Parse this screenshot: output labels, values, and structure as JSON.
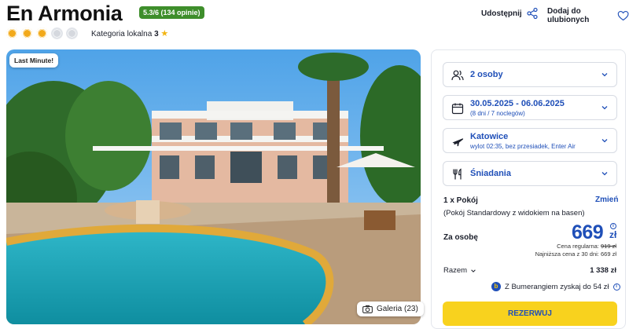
{
  "hotel": {
    "name": "En Armonia",
    "rating_badge": "5.3/6 (134 opinie)",
    "suns_total": 5,
    "suns_filled": 3,
    "category_label": "Kategoria lokalna",
    "category_value": "3",
    "category_star": "★"
  },
  "header_actions": {
    "share_label": "Udostępnij",
    "favorite_label": "Dodaj do ulubionych"
  },
  "photo": {
    "badge": "Last Minute!",
    "gallery_label": "Galeria (23)"
  },
  "booking": {
    "guests": "2 osoby",
    "dates": "30.05.2025 - 06.06.2025",
    "dates_sub": "(8 dni / 7 noclegów)",
    "departure_city": "Katowice",
    "flight_info": "wylot 02:35, bez przesiadek, Enter Air",
    "board": "Śniadania",
    "room_count": "1 x Pokój",
    "change_label": "Zmień",
    "room_desc": "(Pokój Standardowy z widokiem na basen)",
    "per_person_label": "Za osobę",
    "price": "669",
    "currency": "zł",
    "regular_price_label": "Cena regularna:",
    "regular_price": "919 zł",
    "lowest_price_text": "Najniższa cena z 30 dni: 669 zł",
    "total_label": "Razem",
    "total_value": "1 338 zł",
    "bumerang_text": "Z Bumerangiem zyskaj do 54 zł",
    "reserve_label": "REZERWUJ"
  },
  "colors": {
    "accent_blue": "#1f4fb8",
    "rating_green": "#3e8e2b",
    "cta_yellow": "#f8d21e",
    "sun_orange": "#f2a91a"
  }
}
